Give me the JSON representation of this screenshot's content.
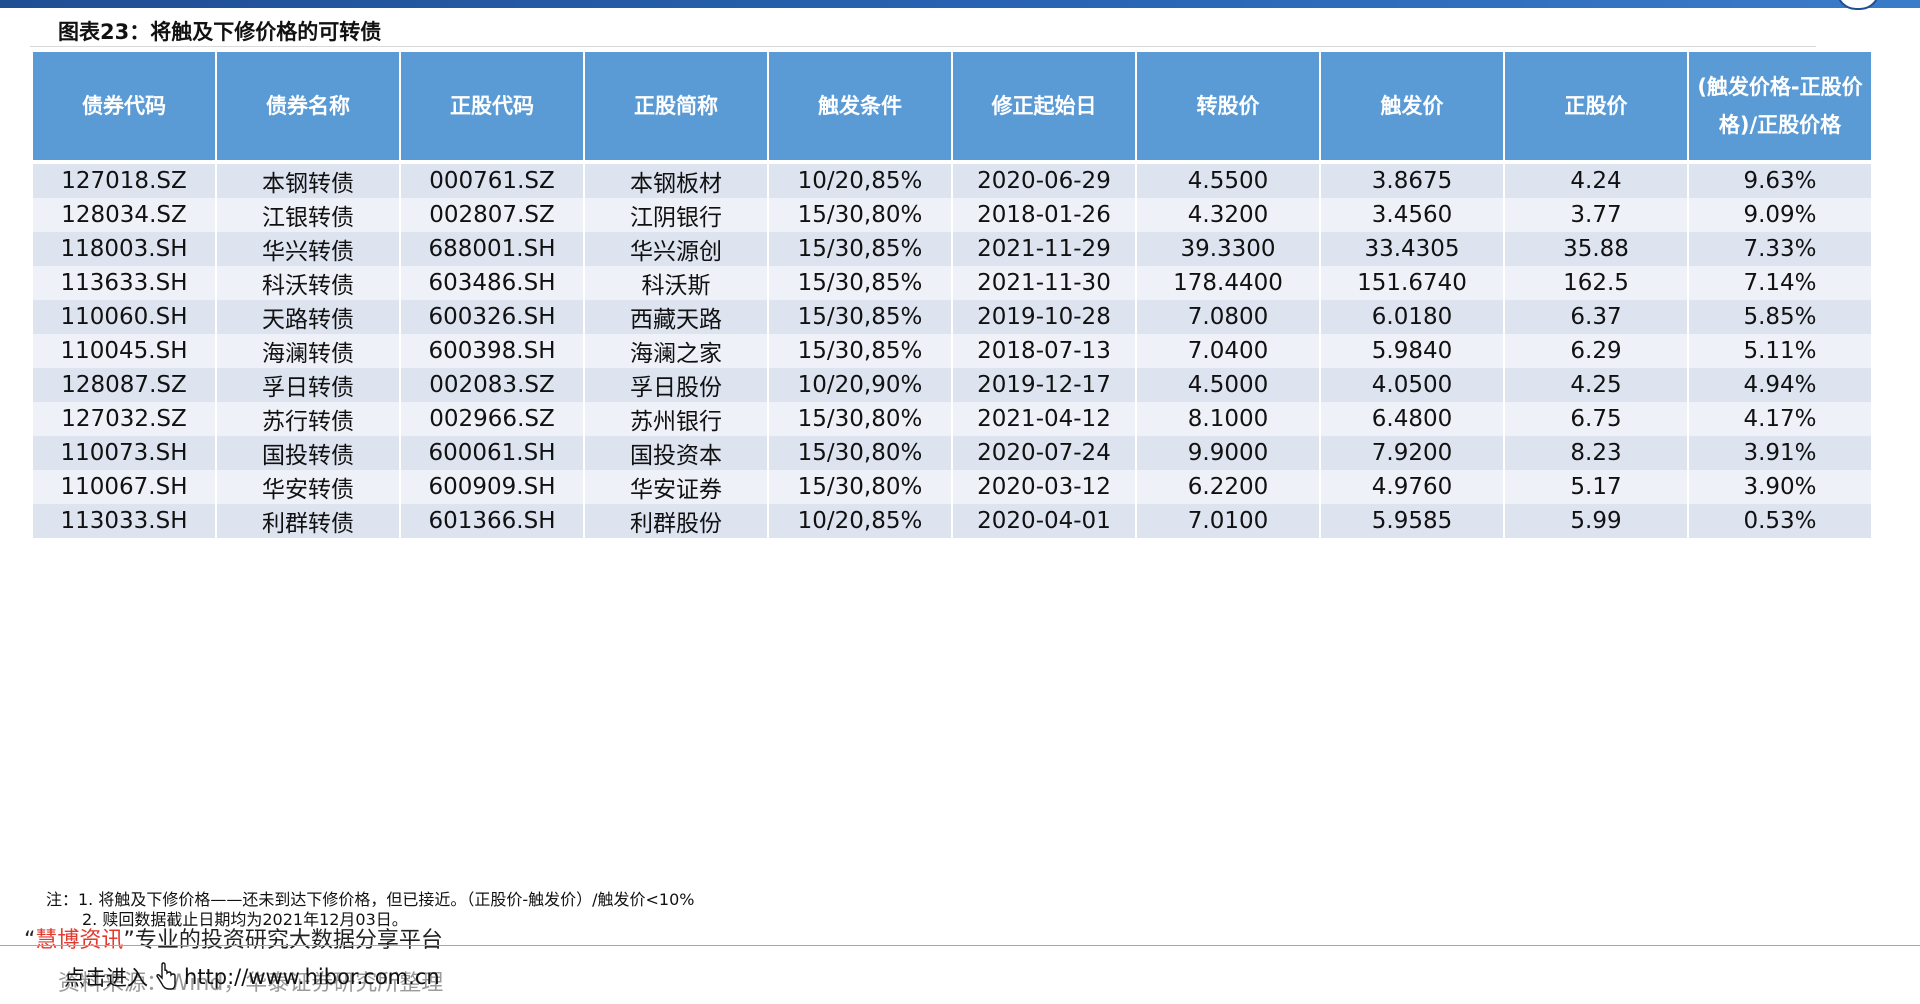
{
  "figure_title": "图表23：将触及下修价格的可转债",
  "table": {
    "headers": [
      "债券代码",
      "债券名称",
      "正股代码",
      "正股简称",
      "触发条件",
      "修正起始日",
      "转股价",
      "触发价",
      "正股价",
      "(触发价格-正股价格)/正股价格"
    ],
    "rows": [
      [
        "127018.SZ",
        "本钢转债",
        "000761.SZ",
        "本钢板材",
        "10/20,85%",
        "2020-06-29",
        "4.5500",
        "3.8675",
        "4.24",
        "9.63%"
      ],
      [
        "128034.SZ",
        "江银转债",
        "002807.SZ",
        "江阴银行",
        "15/30,80%",
        "2018-01-26",
        "4.3200",
        "3.4560",
        "3.77",
        "9.09%"
      ],
      [
        "118003.SH",
        "华兴转债",
        "688001.SH",
        "华兴源创",
        "15/30,85%",
        "2021-11-29",
        "39.3300",
        "33.4305",
        "35.88",
        "7.33%"
      ],
      [
        "113633.SH",
        "科沃转债",
        "603486.SH",
        "科沃斯",
        "15/30,85%",
        "2021-11-30",
        "178.4400",
        "151.6740",
        "162.5",
        "7.14%"
      ],
      [
        "110060.SH",
        "天路转债",
        "600326.SH",
        "西藏天路",
        "15/30,85%",
        "2019-10-28",
        "7.0800",
        "6.0180",
        "6.37",
        "5.85%"
      ],
      [
        "110045.SH",
        "海澜转债",
        "600398.SH",
        "海澜之家",
        "15/30,85%",
        "2018-07-13",
        "7.0400",
        "5.9840",
        "6.29",
        "5.11%"
      ],
      [
        "128087.SZ",
        "孚日转债",
        "002083.SZ",
        "孚日股份",
        "10/20,90%",
        "2019-12-17",
        "4.5000",
        "4.0500",
        "4.25",
        "4.94%"
      ],
      [
        "127032.SZ",
        "苏行转债",
        "002966.SZ",
        "苏州银行",
        "15/30,80%",
        "2021-04-12",
        "8.1000",
        "6.4800",
        "6.75",
        "4.17%"
      ],
      [
        "110073.SH",
        "国投转债",
        "600061.SH",
        "国投资本",
        "15/30,80%",
        "2020-07-24",
        "9.9000",
        "7.9200",
        "8.23",
        "3.91%"
      ],
      [
        "110067.SH",
        "华安转债",
        "600909.SH",
        "华安证券",
        "15/30,80%",
        "2020-03-12",
        "6.2200",
        "4.9760",
        "5.17",
        "3.90%"
      ],
      [
        "113033.SH",
        "利群转债",
        "601366.SH",
        "利群股份",
        "10/20,85%",
        "2020-04-01",
        "7.0100",
        "5.9585",
        "5.99",
        "0.53%"
      ]
    ]
  },
  "notes": {
    "line1": "注：1. 将触及下修价格——还未到达下修价格，但已接近。（正股价-触发价）/触发价<10%",
    "line2": "2. 赎回数据截止日期均为2021年12月03日。"
  },
  "slogan": {
    "open_quote": "“",
    "brand": "慧博资讯",
    "close_quote": "”",
    "text": "专业的投资研究大数据分享平台"
  },
  "source_text": "资料来源：Wind，华泰证券研究所整理",
  "link": {
    "label": "点击进入",
    "url": "http://www.hibor.com.cn"
  },
  "colors": {
    "header_bg": "#5b9bd5",
    "row_odd": "#dde4f0",
    "row_even": "#eef1f7",
    "brand_red": "#e23a2f",
    "top_bar": "#1f4e93"
  }
}
